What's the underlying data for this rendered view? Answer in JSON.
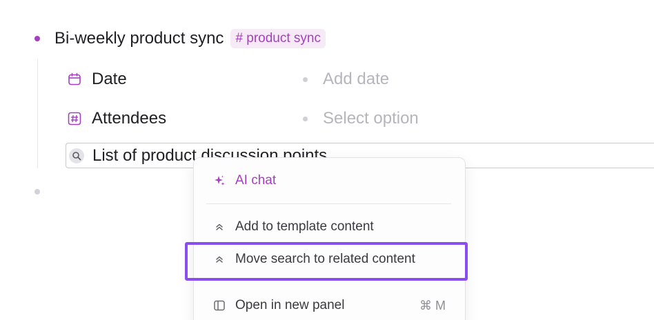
{
  "block": {
    "title": "Bi-weekly product sync",
    "tag": "# product sync"
  },
  "fields": [
    {
      "label": "Date",
      "value": "Add date",
      "icon": "calendar-icon"
    },
    {
      "label": "Attendees",
      "value": "Select option",
      "icon": "hash-icon"
    }
  ],
  "search": {
    "text": "List of product discussion points",
    "icon": "search-icon"
  },
  "menu": {
    "items": [
      {
        "label": "AI chat",
        "icon": "sparkle-icon"
      },
      {
        "label": "Add to template content",
        "icon": "chevrons-up-icon"
      },
      {
        "label": "Move search to related content",
        "icon": "chevrons-up-icon"
      },
      {
        "label": "Open in new panel",
        "icon": "panel-icon",
        "shortcut": "⌘ M"
      }
    ]
  },
  "colors": {
    "accent": "#a63fbf",
    "tag_bg": "#f6eaf7",
    "highlight": "#8a4df0",
    "placeholder": "#b5b5bd"
  }
}
